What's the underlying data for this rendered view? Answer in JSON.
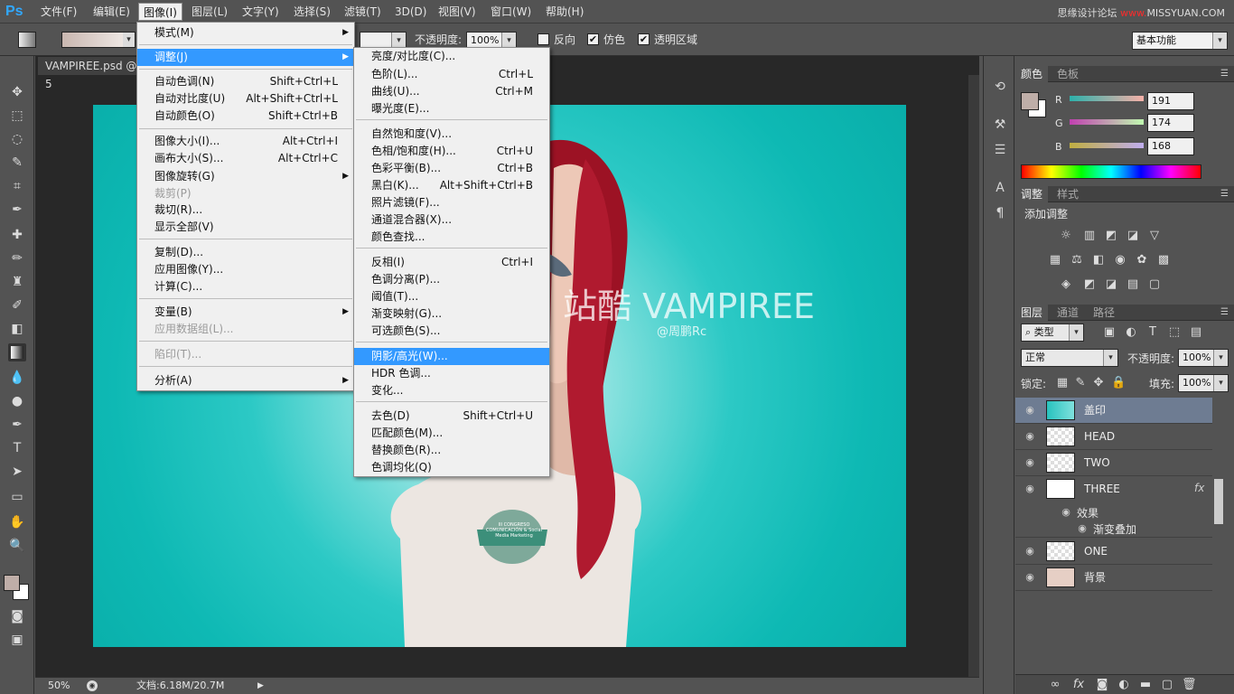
{
  "app": {
    "logo": "Ps",
    "watermark_prefix": "思缘设计论坛",
    "watermark_x": "www.",
    "watermark_site": "MISSYUAN.COM"
  },
  "menubar": [
    "文件(F)",
    "编辑(E)",
    "图像(I)",
    "图层(L)",
    "文字(Y)",
    "选择(S)",
    "滤镜(T)",
    "3D(D)",
    "视图(V)",
    "窗口(W)",
    "帮助(H)"
  ],
  "options": {
    "opacity_label": "不透明度:",
    "opacity_value": "100%",
    "reverse_label": "反向",
    "dither_label": "仿色",
    "transparency_label": "透明区域",
    "workspace": "基本功能"
  },
  "document": {
    "tab_label": "VAMPIREE.psd @ 5",
    "zoom": "50%",
    "doc_info": "文档:6.18M/20.7M",
    "canvas_title": "站酷 VAMPIREE",
    "canvas_subtitle": "@周鹏Rc",
    "badge_text": "III CONGRESO COMUNICACIÓN & Social Media Marketing"
  },
  "image_menu": {
    "items": [
      {
        "label": "模式(M)",
        "shortcut": "",
        "submenu": true
      },
      {
        "label": "调整(J)",
        "shortcut": "",
        "submenu": true,
        "highlighted": true
      },
      {
        "label": "自动色调(N)",
        "shortcut": "Shift+Ctrl+L"
      },
      {
        "label": "自动对比度(U)",
        "shortcut": "Alt+Shift+Ctrl+L"
      },
      {
        "label": "自动颜色(O)",
        "shortcut": "Shift+Ctrl+B"
      },
      {
        "label": "图像大小(I)...",
        "shortcut": "Alt+Ctrl+I"
      },
      {
        "label": "画布大小(S)...",
        "shortcut": "Alt+Ctrl+C"
      },
      {
        "label": "图像旋转(G)",
        "shortcut": "",
        "submenu": true
      },
      {
        "label": "裁剪(P)",
        "shortcut": "",
        "disabled": true
      },
      {
        "label": "裁切(R)...",
        "shortcut": ""
      },
      {
        "label": "显示全部(V)",
        "shortcut": ""
      },
      {
        "label": "复制(D)...",
        "shortcut": ""
      },
      {
        "label": "应用图像(Y)...",
        "shortcut": ""
      },
      {
        "label": "计算(C)...",
        "shortcut": ""
      },
      {
        "label": "变量(B)",
        "shortcut": "",
        "submenu": true
      },
      {
        "label": "应用数据组(L)...",
        "shortcut": "",
        "disabled": true
      },
      {
        "label": "陷印(T)...",
        "shortcut": "",
        "disabled": true
      },
      {
        "label": "分析(A)",
        "shortcut": "",
        "submenu": true
      }
    ]
  },
  "adjust_menu": {
    "items": [
      {
        "label": "亮度/对比度(C)...",
        "shortcut": ""
      },
      {
        "label": "色阶(L)...",
        "shortcut": "Ctrl+L"
      },
      {
        "label": "曲线(U)...",
        "shortcut": "Ctrl+M"
      },
      {
        "label": "曝光度(E)...",
        "shortcut": ""
      },
      {
        "label": "自然饱和度(V)...",
        "shortcut": ""
      },
      {
        "label": "色相/饱和度(H)...",
        "shortcut": "Ctrl+U"
      },
      {
        "label": "色彩平衡(B)...",
        "shortcut": "Ctrl+B"
      },
      {
        "label": "黑白(K)...",
        "shortcut": "Alt+Shift+Ctrl+B"
      },
      {
        "label": "照片滤镜(F)...",
        "shortcut": ""
      },
      {
        "label": "通道混合器(X)...",
        "shortcut": ""
      },
      {
        "label": "颜色查找...",
        "shortcut": ""
      },
      {
        "label": "反相(I)",
        "shortcut": "Ctrl+I"
      },
      {
        "label": "色调分离(P)...",
        "shortcut": ""
      },
      {
        "label": "阈值(T)...",
        "shortcut": ""
      },
      {
        "label": "渐变映射(G)...",
        "shortcut": ""
      },
      {
        "label": "可选颜色(S)...",
        "shortcut": ""
      },
      {
        "label": "阴影/高光(W)...",
        "shortcut": "",
        "highlighted": true
      },
      {
        "label": "HDR 色调...",
        "shortcut": ""
      },
      {
        "label": "变化...",
        "shortcut": ""
      },
      {
        "label": "去色(D)",
        "shortcut": "Shift+Ctrl+U"
      },
      {
        "label": "匹配颜色(M)...",
        "shortcut": ""
      },
      {
        "label": "替换颜色(R)...",
        "shortcut": ""
      },
      {
        "label": "色调均化(Q)",
        "shortcut": ""
      }
    ]
  },
  "color_panel": {
    "tabs": [
      "颜色",
      "色板"
    ],
    "r_label": "R",
    "g_label": "G",
    "b_label": "B",
    "r": "191",
    "g": "174",
    "b": "168",
    "foreground": "#bfaea8"
  },
  "adjust_panel": {
    "tabs": [
      "调整",
      "样式"
    ],
    "add_label": "添加调整"
  },
  "layers_panel": {
    "tabs": [
      "图层",
      "通道",
      "路径"
    ],
    "kind_filter": "类型",
    "blend_mode": "正常",
    "opacity_label": "不透明度:",
    "opacity": "100%",
    "lock_label": "锁定:",
    "fill_label": "填充:",
    "fill": "100%",
    "effects_label": "效果",
    "effect_name": "渐变叠加",
    "layers": [
      "盖印",
      "HEAD",
      "TWO",
      "THREE",
      "ONE",
      "背景"
    ]
  }
}
